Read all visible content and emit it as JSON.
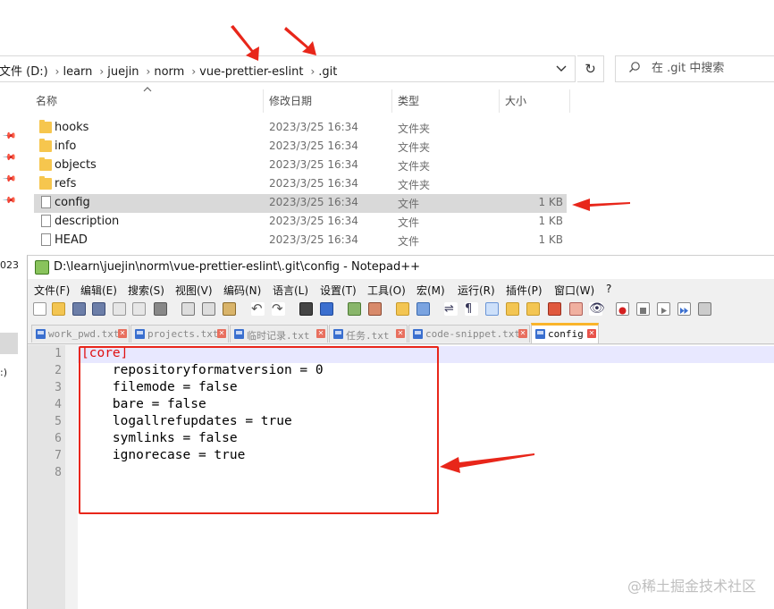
{
  "explorer": {
    "breadcrumb": [
      "文件 (D:)",
      "learn",
      "juejin",
      "norm",
      "vue-prettier-eslint",
      ".git"
    ],
    "search_placeholder": "在 .git 中搜索",
    "columns": {
      "name": "名称",
      "date": "修改日期",
      "type": "类型",
      "size": "大小"
    },
    "rows": [
      {
        "name": "hooks",
        "date": "2023/3/25 16:34",
        "type": "文件夹",
        "size": "",
        "kind": "folder"
      },
      {
        "name": "info",
        "date": "2023/3/25 16:34",
        "type": "文件夹",
        "size": "",
        "kind": "folder"
      },
      {
        "name": "objects",
        "date": "2023/3/25 16:34",
        "type": "文件夹",
        "size": "",
        "kind": "folder"
      },
      {
        "name": "refs",
        "date": "2023/3/25 16:34",
        "type": "文件夹",
        "size": "",
        "kind": "folder"
      },
      {
        "name": "config",
        "date": "2023/3/25 16:34",
        "type": "文件",
        "size": "1 KB",
        "kind": "file",
        "selected": true
      },
      {
        "name": "description",
        "date": "2023/3/25 16:34",
        "type": "文件",
        "size": "1 KB",
        "kind": "file"
      },
      {
        "name": "HEAD",
        "date": "2023/3/25 16:34",
        "type": "文件",
        "size": "1 KB",
        "kind": "file"
      }
    ],
    "left_pane_text": [
      "023",
      ":)"
    ]
  },
  "notepad": {
    "title": "D:\\learn\\juejin\\norm\\vue-prettier-eslint\\.git\\config - Notepad++",
    "menu": [
      "文件(F)",
      "编辑(E)",
      "搜索(S)",
      "视图(V)",
      "编码(N)",
      "语言(L)",
      "设置(T)",
      "工具(O)",
      "宏(M)",
      "运行(R)",
      "插件(P)",
      "窗口(W)",
      "?"
    ],
    "tabs": [
      "work_pwd.txt",
      "projects.txt",
      "临时记录.txt",
      "任务.txt",
      "code-snippet.txt",
      "config"
    ],
    "active_tab": "config",
    "lines": [
      "[core]",
      "    repositoryformatversion = 0",
      "    filemode = false",
      "    bare = false",
      "    logallrefupdates = true",
      "    symlinks = false",
      "    ignorecase = true",
      ""
    ],
    "line_numbers": [
      "1",
      "2",
      "3",
      "4",
      "5",
      "6",
      "7",
      "8"
    ]
  },
  "watermark": "@稀土掘金技术社区",
  "colors": {
    "annotation": "#e8261a",
    "selection": "#d9d9d9",
    "folder": "#f6c64e",
    "active_tab_accent": "#fab42a"
  }
}
